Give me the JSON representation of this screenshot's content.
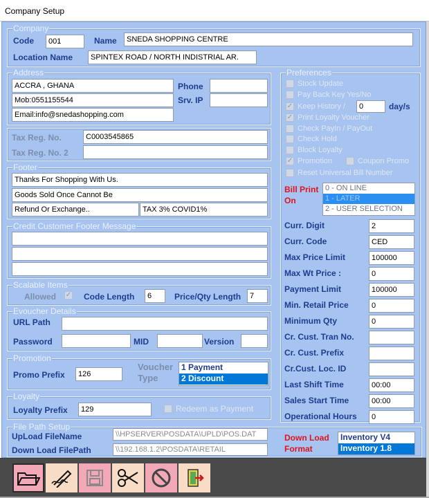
{
  "window": {
    "title": "Company Setup"
  },
  "company": {
    "legend": "Company",
    "code_label": "Code",
    "code_value": "001",
    "name_label": "Name",
    "name_value": "SNEDA SHOPPING CENTRE",
    "location_label": "Location Name",
    "location_value": "SPINTEX ROAD / NORTH INDISTRIAL AR."
  },
  "address": {
    "legend": "Address",
    "line1": "ACCRA , GHANA",
    "line2": "Mob:0551155544",
    "line3": "Email:info@snedashopping.com",
    "phone_label": "Phone",
    "phone_value": "",
    "srv_ip_label": "Srv. IP",
    "srv_ip_value": ""
  },
  "tax": {
    "reg_label": "Tax Reg. No.",
    "reg_value": "C0003545865",
    "reg2_label": "Tax Reg. No. 2",
    "reg2_value": ""
  },
  "footer": {
    "legend": "Footer",
    "line1": "Thanks For Shopping With Us.",
    "line2": "Goods Sold Once Cannot Be",
    "line3a": "Refund Or Exchange..",
    "line3b": "TAX 3% COVID1%"
  },
  "credit_footer": {
    "legend": "Credit Customer Footer Message",
    "line1": "",
    "line2": "",
    "line3": ""
  },
  "scalable": {
    "legend": "Scalable Items",
    "allowed_label": "Allowed",
    "allowed_check": "✓",
    "code_length_label": "Code Length",
    "code_length_value": "6",
    "price_qty_label": "Price/Qty Length",
    "price_qty_value": "7"
  },
  "evoucher": {
    "legend": "Evoucher Details",
    "url_label": "URL Path",
    "url_value": "",
    "password_label": "Password",
    "password_value": "",
    "mid_label": "MID",
    "mid_value": "",
    "version_label": "Version",
    "version_value": ""
  },
  "promotion": {
    "legend": "Promotion",
    "prefix_label": "Promo Prefix",
    "prefix_value": "126",
    "voucher_label_1": "Voucher",
    "voucher_label_2": "Type",
    "voucher_options": [
      "1  Payment",
      "2  Discount"
    ]
  },
  "loyalty": {
    "legend": "Loyalty",
    "prefix_label": "Loyalty Prefix",
    "prefix_value": "129",
    "redeem_label": "Redeem as Payment"
  },
  "filepath": {
    "legend": "File Path Setup",
    "upload_label": "UpLoad FileName",
    "upload_value": "\\\\HPSERVER\\POSDATA\\UPLD\\POS.DAT",
    "download_label": "Down Load FilePath",
    "download_value": "\\\\192.168.1.2\\POSDATA\\RETAIL",
    "format_label_1": "Down Load",
    "format_label_2": "Format",
    "format_options": [
      "Inventory V4",
      "Inventory 1.8"
    ]
  },
  "preferences": {
    "legend": "Preferences",
    "stock_update": "Stock Update",
    "pay_back_key": "Pay Back Key Yes/No",
    "keep_history": "Keep History /",
    "keep_history_days": "0",
    "days_label": "day/s",
    "print_loyalty": "Print Loyalty Voucher",
    "check_payin": "Check PayIn / PayOut",
    "check_hold": "Check Hold",
    "block_loyalty": "Block Loyalty",
    "promotion": "Promotion",
    "coupon_promo": "Coupon Promo",
    "reset_bill": "Reset Universal Bill Number",
    "check_mark": "✓",
    "bill_print_label_1": "Bill Print",
    "bill_print_label_2": "On",
    "bill_print_options": [
      "0 - ON LINE",
      "1 - LATER",
      "2 - USER SELECTION"
    ],
    "fields": [
      {
        "label": "Curr. Digit",
        "value": "2"
      },
      {
        "label": "Curr. Code",
        "value": "CED"
      },
      {
        "label": "Max Price Limit",
        "value": "100000"
      },
      {
        "label": "Max Wt Price :",
        "value": "0"
      },
      {
        "label": "Payment Limit",
        "value": "100000"
      },
      {
        "label": "Min. Retail Price",
        "value": "0"
      },
      {
        "label": "Minimum Qty",
        "value": "0"
      },
      {
        "label": "Cr. Cust. Tran No.",
        "value": ""
      },
      {
        "label": "Cr. Cust. Prefix",
        "value": ""
      },
      {
        "label": "Cr.Cust. Loc. ID",
        "value": ""
      },
      {
        "label": "Last Shift Time",
        "value": "00:00"
      },
      {
        "label": "Sales Start Time",
        "value": "00:00"
      },
      {
        "label": "Operational Hours",
        "value": "0"
      }
    ]
  },
  "toolbar": {
    "buttons": [
      "open-folder-icon",
      "edit-pen-icon",
      "save-disk-icon",
      "cut-scissors-icon",
      "cancel-icon",
      "exit-door-icon"
    ]
  }
}
